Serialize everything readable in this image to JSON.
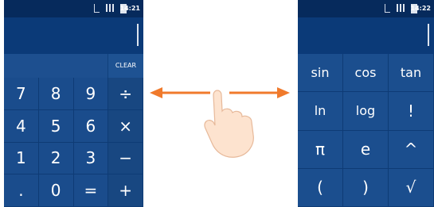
{
  "left_screen": {
    "status_time": "14:21",
    "clear_label": "CLEAR",
    "keys": [
      "7",
      "8",
      "9",
      "÷",
      "4",
      "5",
      "6",
      "×",
      "1",
      "2",
      "3",
      "−",
      ".",
      "0",
      "=",
      "+"
    ]
  },
  "right_screen": {
    "status_time": "14:22",
    "keys": [
      "sin",
      "cos",
      "tan",
      "ln",
      "log",
      "!",
      "π",
      "e",
      "^",
      "(",
      ")",
      "√"
    ]
  },
  "colors": {
    "phone_bg": "#0b3a78",
    "key_bg": "#1a4c8c",
    "arrow": "#f07a2c"
  },
  "icons": [
    "network-icon",
    "signal-icon",
    "battery-icon",
    "swipe-arrow-left-icon",
    "swipe-arrow-right-icon",
    "hand-gesture-icon"
  ]
}
